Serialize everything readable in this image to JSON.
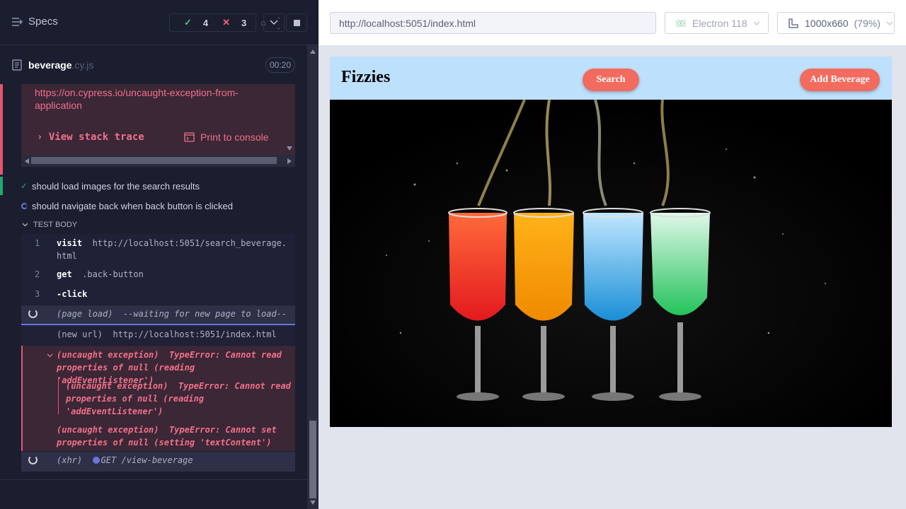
{
  "reporter": {
    "specs_label": "Specs",
    "stats": {
      "passed": "4",
      "failed": "3",
      "pending": "--"
    },
    "spec_file": {
      "name": "beverage",
      "ext": ".cy.js",
      "duration": "00:20"
    },
    "error": {
      "link": "https://on.cypress.io/uncaught-exception-from-application",
      "view_stack_trace": "View stack trace",
      "print_to_console": "Print to console"
    },
    "tests": [
      {
        "title": "should load images for the search results",
        "state": "passed"
      },
      {
        "title": "should navigate back when back button is clicked",
        "state": "running"
      }
    ],
    "test_body_label": "TEST BODY",
    "commands": [
      {
        "num": "1",
        "name": "visit",
        "arg": "http://localhost:5051/search_beverage.html"
      },
      {
        "num": "2",
        "name": "get",
        "arg": ".back-button"
      },
      {
        "num": "3",
        "name": "-click",
        "arg": ""
      }
    ],
    "page_load": {
      "name": "(page load)",
      "message": "--waiting for new page to load--"
    },
    "new_url": {
      "name": "(new url)",
      "message": "http://localhost:5051/index.html"
    },
    "exceptions": [
      {
        "name": "(uncaught exception)",
        "message": "TypeError: Cannot read properties of null (reading 'addEventListener')"
      },
      {
        "name": "(uncaught exception)",
        "message": "TypeError: Cannot read properties of null (reading 'addEventListener')"
      },
      {
        "name": "(uncaught exception)",
        "message": "TypeError: Cannot set properties of null (setting 'textContent')"
      }
    ],
    "xhr": {
      "name": "(xhr)",
      "message": "GET /view-beverage"
    }
  },
  "aut": {
    "url": "http://localhost:5051/index.html",
    "browser": "Electron 118",
    "viewport": "1000x660",
    "scale": "(79%)",
    "app": {
      "title": "Fizzies",
      "search_button": "Search",
      "add_button": "Add Beverage"
    }
  },
  "colors": {
    "accent_pass": "#1fa971",
    "accent_fail": "#e45770",
    "header_bg": "#bde0fd",
    "app_button": "#f26b5e"
  }
}
